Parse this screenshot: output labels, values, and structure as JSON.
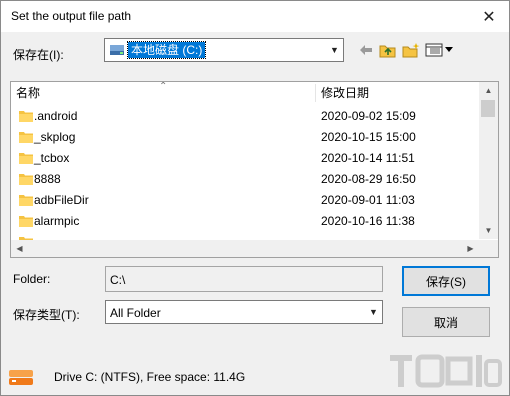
{
  "window": {
    "title": "Set the output file path"
  },
  "lookin": {
    "label": "保存在(I):",
    "value": "本地磁盘 (C:)"
  },
  "list": {
    "columns": {
      "name": "名称",
      "date": "修改日期"
    },
    "rows": [
      {
        "name": ".android",
        "date": "2020-09-02 15:09"
      },
      {
        "name": "_skplog",
        "date": "2020-10-15 15:00"
      },
      {
        "name": "_tcbox",
        "date": "2020-10-14 11:51"
      },
      {
        "name": "8888",
        "date": "2020-08-29 16:50"
      },
      {
        "name": "adbFileDir",
        "date": "2020-09-01 11:03"
      },
      {
        "name": "alarmpic",
        "date": "2020-10-16 11:38"
      },
      {
        "name": "",
        "date": ""
      }
    ]
  },
  "folder": {
    "label": "Folder:",
    "value": "C:\\"
  },
  "filetype": {
    "label": "保存类型(T):",
    "value": "All Folder"
  },
  "buttons": {
    "save": "保存(S)",
    "cancel": "取消"
  },
  "status": {
    "text": "Drive C: (NTFS),   Free space: 11.4G"
  },
  "icons": {
    "close": "close-icon",
    "drive": "drive-icon",
    "back": "back-arrow-icon",
    "up": "up-folder-icon",
    "new_folder": "new-folder-icon",
    "views": "view-menu-icon",
    "folder": "folder-icon",
    "status_drive": "drive-status-icon"
  },
  "colors": {
    "selection": "#0078d7",
    "folder": "#f5c342",
    "drive_status": "#f07a1a"
  }
}
